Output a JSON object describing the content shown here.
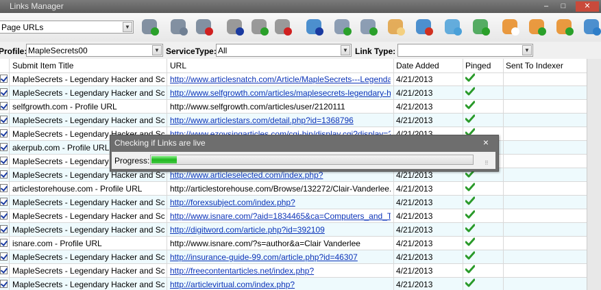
{
  "window": {
    "title": "Links Manager"
  },
  "toolbar": {
    "view_select": "Page URLs",
    "buttons": [
      {
        "name": "add-link-icon"
      },
      {
        "name": "link-icon"
      },
      {
        "name": "remove-link-icon"
      },
      {
        "name": "filter-check-icon"
      },
      {
        "name": "filter-up-icon"
      },
      {
        "name": "filter-remove-icon"
      },
      {
        "name": "network-icon"
      },
      {
        "name": "database-export-icon"
      },
      {
        "name": "search-link-icon"
      },
      {
        "name": "grid-icon"
      },
      {
        "name": "globe-icon"
      },
      {
        "name": "tag-icon"
      },
      {
        "name": "add-bookmark-icon"
      },
      {
        "name": "rss-icon"
      },
      {
        "name": "rss-info-icon"
      },
      {
        "name": "rss-add-icon"
      },
      {
        "name": "refresh-icon"
      }
    ]
  },
  "filters": {
    "profile_label": "Profile:",
    "profile_value": "MapleSecrets00",
    "service_label": "ServiceType:",
    "service_value": "All",
    "linktype_label": "Link Type:",
    "linktype_value": ""
  },
  "grid": {
    "columns": [
      "Submit Item Title",
      "URL",
      "Date Added",
      "Pinged",
      "Sent To Indexer"
    ],
    "rows": [
      {
        "title": "MapleSecrets - Legendary Hacker and Sc...",
        "url": "http://www.articlesnatch.com/Article/MapleSecrets---Legendar...",
        "url_linked": true,
        "date": "4/21/2013",
        "pinged": true
      },
      {
        "title": "MapleSecrets - Legendary Hacker and Sc...",
        "url": "http://www.selfgrowth.com/articles/maplesecrets-legendary-ha...",
        "url_linked": true,
        "date": "4/21/2013",
        "pinged": true
      },
      {
        "title": "selfgrowth.com - Profile URL",
        "url": "http://www.selfgrowth.com/articles/user/2120111",
        "url_linked": false,
        "date": "4/21/2013",
        "pinged": true
      },
      {
        "title": "MapleSecrets - Legendary Hacker and Sc...",
        "url": "http://www.articlestars.com/detail.php?id=1368796",
        "url_linked": true,
        "date": "4/21/2013",
        "pinged": true
      },
      {
        "title": "MapleSecrets - Legendary Hacker and Sc...",
        "url": "http://www.ezoysingarticles.com/cgi-bin/display.cgi?display=2...",
        "url_linked": true,
        "date": "4/21/2013",
        "pinged": true
      },
      {
        "title": "akerpub.com - Profile URL",
        "url": "",
        "url_linked": false,
        "date": "",
        "pinged": false
      },
      {
        "title": "MapleSecrets - Legendary H",
        "url": "",
        "url_linked": false,
        "date": "",
        "pinged": false
      },
      {
        "title": "MapleSecrets - Legendary Hacker and Sc...",
        "url": "http://www.articleselected.com/index.php?",
        "url_linked": true,
        "date": "4/21/2013",
        "pinged": true
      },
      {
        "title": "articlestorehouse.com - Profile URL",
        "url": "http://articlestorehouse.com/Browse/132272/Clair-Vanderlee.h...",
        "url_linked": false,
        "date": "4/21/2013",
        "pinged": true
      },
      {
        "title": "MapleSecrets - Legendary Hacker and Sc...",
        "url": "http://forexsubject.com/index.php?",
        "url_linked": true,
        "date": "4/21/2013",
        "pinged": true
      },
      {
        "title": "MapleSecrets - Legendary Hacker and Sc...",
        "url": "http://www.isnare.com/?aid=1834465&ca=Computers_and_Tec...",
        "url_linked": true,
        "date": "4/21/2013",
        "pinged": true
      },
      {
        "title": "MapleSecrets - Legendary Hacker and Sc...",
        "url": "http://digitword.com/article.php?id=392109",
        "url_linked": true,
        "date": "4/21/2013",
        "pinged": true
      },
      {
        "title": "isnare.com - Profile URL",
        "url": "http://www.isnare.com/?s=author&a=Clair Vanderlee",
        "url_linked": false,
        "date": "4/21/2013",
        "pinged": true
      },
      {
        "title": "MapleSecrets - Legendary Hacker and Sc...",
        "url": "http://insurance-guide-99.com/article.php?id=46307",
        "url_linked": true,
        "date": "4/21/2013",
        "pinged": true
      },
      {
        "title": "MapleSecrets - Legendary Hacker and Sc...",
        "url": "http://freecontentarticles.net/index.php?",
        "url_linked": true,
        "date": "4/21/2013",
        "pinged": true
      },
      {
        "title": "MapleSecrets - Legendary Hacker and Sc...",
        "url": "http://articlevirtual.com/index.php?",
        "url_linked": true,
        "date": "4/21/2013",
        "pinged": true
      }
    ]
  },
  "dialog": {
    "title": "Checking if Links are live",
    "close_glyph": "×",
    "progress_label": "Progress:",
    "progress_fraction": 0.08
  }
}
